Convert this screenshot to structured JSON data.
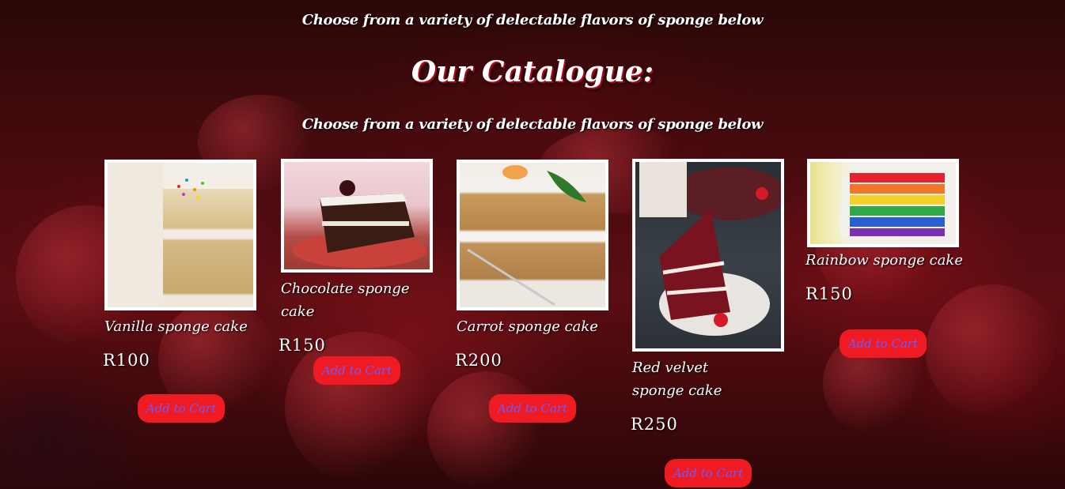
{
  "header": {
    "top_tagline": "Choose from a variety of delectable flavors of sponge below",
    "title": "Our Catalogue:",
    "sub_tagline": "Choose from a variety of delectable flavors of sponge below"
  },
  "products": [
    {
      "name": "Vanilla sponge cake",
      "price": "R100",
      "button": "Add to Cart",
      "image": "vanilla-cake-photo"
    },
    {
      "name": "Chocolate sponge cake",
      "price": "R150",
      "button": "Add to Cart",
      "image": "chocolate-cake-photo"
    },
    {
      "name": "Carrot sponge cake",
      "price": "R200",
      "button": "Add to Cart",
      "image": "carrot-cake-photo"
    },
    {
      "name": "Red velvet sponge cake",
      "price": "R250",
      "button": "Add to Cart",
      "image": "red-velvet-cake-photo"
    },
    {
      "name": "Rainbow sponge cake",
      "price": "R150",
      "button": "Add to Cart",
      "image": "rainbow-cake-photo"
    }
  ],
  "colors": {
    "button_bg": "#f01a22",
    "button_text": "#6a5bff",
    "title_shadow": "#b3001b"
  }
}
